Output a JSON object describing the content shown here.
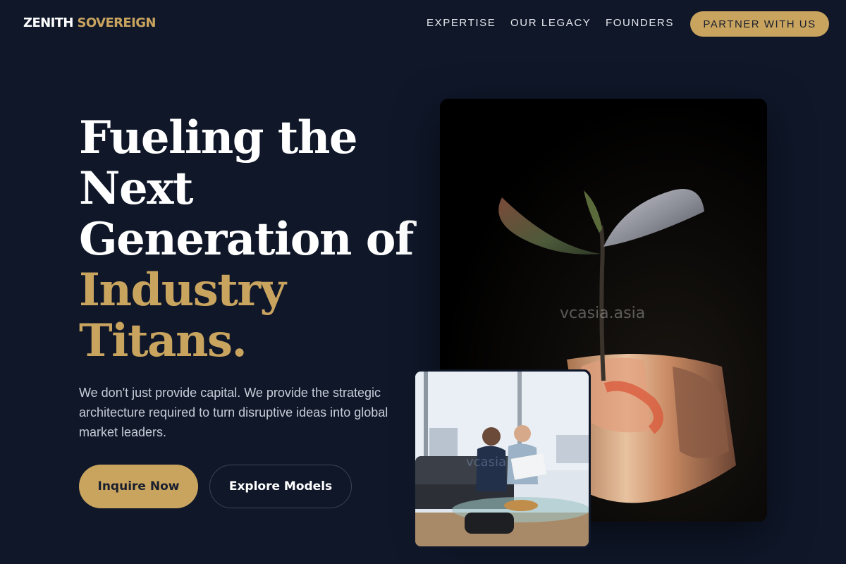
{
  "brand": {
    "name_primary": "ZENITH",
    "name_accent": "SOVEREIGN",
    "accent_color": "#c9a45f",
    "background": "#0f1729"
  },
  "nav": {
    "links": [
      "EXPERTISE",
      "OUR LEGACY",
      "FOUNDERS"
    ],
    "cta_label": "PARTNER WITH US"
  },
  "hero": {
    "headline_lines": [
      "Fueling the",
      "Next",
      "Generation of"
    ],
    "headline_accent_lines": [
      "Industry",
      "Titans."
    ],
    "subtext": "We don't just provide capital. We provide the strategic architecture required to turn disruptive ideas into global market leaders.",
    "primary_button": "Inquire Now",
    "secondary_button": "Explore Models"
  },
  "images": {
    "main_watermark": "vcasia.asia",
    "small_watermark": "vcasia"
  }
}
